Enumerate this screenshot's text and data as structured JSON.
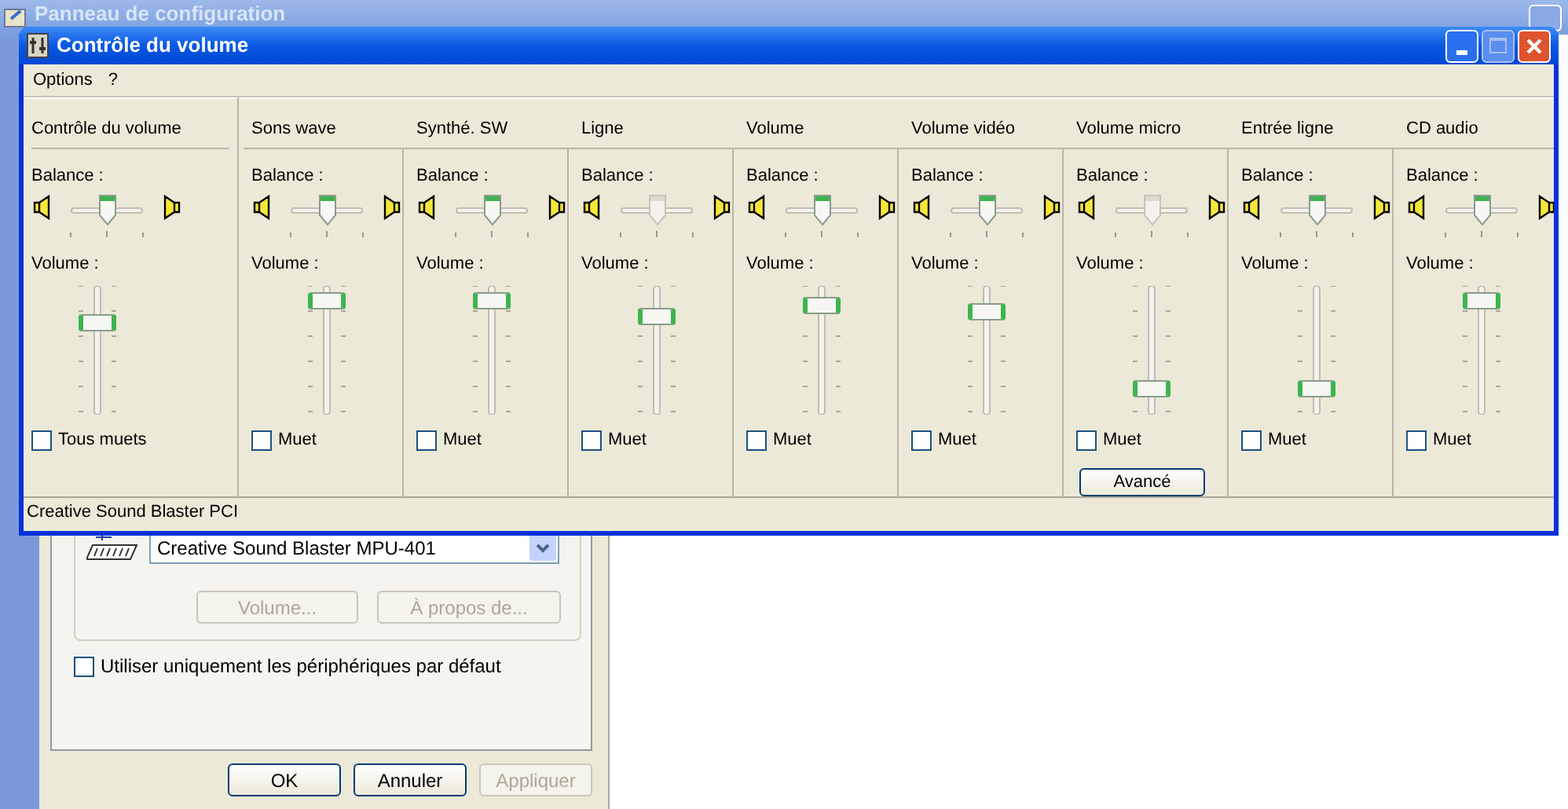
{
  "background_window": {
    "title": "Panneau de configuration"
  },
  "sound_dialog": {
    "device": {
      "value": "Creative Sound Blaster MPU-401"
    },
    "device_buttons": [
      {
        "label": "Volume...",
        "disabled": true
      },
      {
        "label": "À propos de...",
        "disabled": true
      }
    ],
    "default_devices_checkbox": {
      "label": "Utiliser uniquement les périphériques par défaut",
      "checked": false
    },
    "footer_buttons": [
      {
        "label": "OK",
        "disabled": false
      },
      {
        "label": "Annuler",
        "disabled": false
      },
      {
        "label": "Appliquer",
        "disabled": true
      }
    ]
  },
  "window": {
    "title": "Contrôle du volume"
  },
  "menu": [
    "Options",
    "?"
  ],
  "channels": [
    {
      "kind": "master",
      "name": "Contrôle du volume",
      "balance_label": "Balance :",
      "balance": {
        "level": 0.5,
        "disabled": false
      },
      "volume_label": "Volume :",
      "volume": {
        "level": 0.75
      },
      "mute": {
        "label": "Tous muets",
        "checked": false
      }
    },
    {
      "kind": "channel",
      "name": "Sons wave",
      "balance_label": "Balance :",
      "balance": {
        "level": 0.5,
        "disabled": false
      },
      "volume_label": "Volume :",
      "volume": {
        "level": 0.95
      },
      "mute": {
        "label": "Muet",
        "checked": false
      }
    },
    {
      "kind": "channel",
      "name": "Synthé. SW",
      "balance_label": "Balance :",
      "balance": {
        "level": 0.5,
        "disabled": false
      },
      "volume_label": "Volume :",
      "volume": {
        "level": 0.95
      },
      "mute": {
        "label": "Muet",
        "checked": false
      }
    },
    {
      "kind": "channel",
      "name": "Ligne",
      "balance_label": "Balance :",
      "balance": {
        "level": 0.5,
        "disabled": true
      },
      "volume_label": "Volume :",
      "volume": {
        "level": 0.8
      },
      "mute": {
        "label": "Muet",
        "checked": false
      }
    },
    {
      "kind": "channel",
      "name": "Volume",
      "balance_label": "Balance :",
      "balance": {
        "level": 0.5,
        "disabled": false
      },
      "volume_label": "Volume :",
      "volume": {
        "level": 0.9
      },
      "mute": {
        "label": "Muet",
        "checked": false
      }
    },
    {
      "kind": "channel",
      "name": "Volume vidéo",
      "balance_label": "Balance :",
      "balance": {
        "level": 0.5,
        "disabled": false
      },
      "volume_label": "Volume :",
      "volume": {
        "level": 0.85
      },
      "mute": {
        "label": "Muet",
        "checked": false
      }
    },
    {
      "kind": "channel",
      "name": "Volume micro",
      "balance_label": "Balance :",
      "balance": {
        "level": 0.5,
        "disabled": true
      },
      "volume_label": "Volume :",
      "volume": {
        "level": 0.15
      },
      "mute": {
        "label": "Muet",
        "checked": false
      },
      "button": "Avancé"
    },
    {
      "kind": "channel",
      "name": "Entrée ligne",
      "balance_label": "Balance :",
      "balance": {
        "level": 0.5,
        "disabled": false
      },
      "volume_label": "Volume :",
      "volume": {
        "level": 0.15
      },
      "mute": {
        "label": "Muet",
        "checked": false
      }
    },
    {
      "kind": "channel",
      "name": "CD audio",
      "balance_label": "Balance :",
      "balance": {
        "level": 0.5,
        "disabled": false
      },
      "volume_label": "Volume :",
      "volume": {
        "level": 0.95
      },
      "mute": {
        "label": "Muet",
        "checked": false
      }
    }
  ],
  "status_bar": "Creative Sound Blaster PCI"
}
